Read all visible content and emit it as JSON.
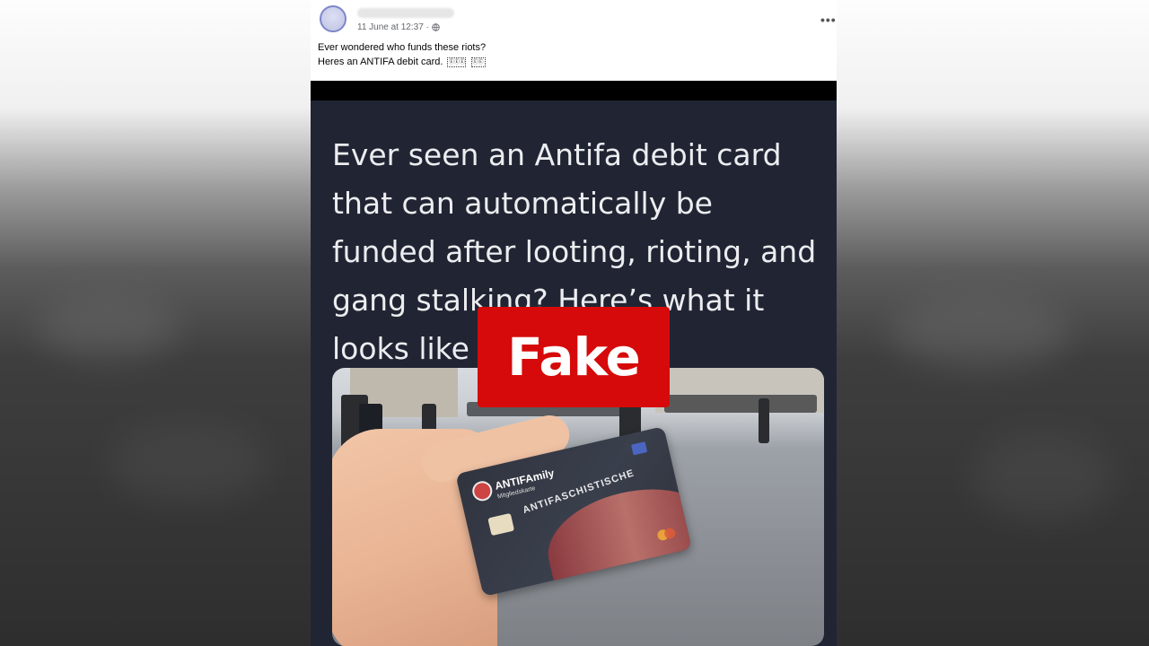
{
  "post": {
    "meta": {
      "timestamp": "11 June at 12:37 ·",
      "audience_icon": "globe-icon"
    },
    "more_label": "•••",
    "caption": {
      "line1": "Ever wondered who funds these riots?",
      "line2": "Heres an ANTIFA debit card.",
      "emoji_placeholders": [
        "ⒺⒺⒺ",
        "ⒺⒺ"
      ]
    }
  },
  "media": {
    "tweet_lines": [
      "Ever seen an Antifa debit card",
      "that can automatically be",
      "funded after looting, rioting, and",
      "gang stalking? Here’s what it",
      "looks like"
    ],
    "card": {
      "brand": "ANTIFAmily",
      "subtitle": "Mitgliedskarte",
      "arc_text": "ANTIFASCHISTISCHE"
    }
  },
  "label": {
    "text": "Fake",
    "color": "#d60a0a"
  }
}
